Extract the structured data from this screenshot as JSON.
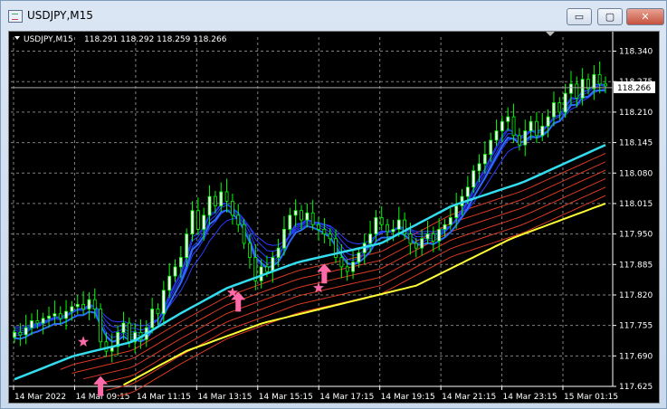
{
  "window": {
    "title": "USDJPY,M15",
    "controls": {
      "minimize": "▭",
      "maximize": "▢",
      "close": "✕"
    }
  },
  "chart_header": {
    "symbol": "USDJPY,M15",
    "ohlc": "118.291 118.292 118.259 118.266"
  },
  "colors": {
    "background": "#000000",
    "grid": "#808080",
    "axis_text": "#ffffff",
    "candle_up": "#00ff00",
    "candle_body_up": "#ffffff",
    "candle_down": "#00ff00",
    "blue_ma": "#2a3bff",
    "cyan_ma": "#33ddee",
    "red_ma": "#d93a22",
    "yellow_ma": "#ffff33",
    "markers": "#ff6aa8"
  },
  "chart_data": {
    "type": "candlestick",
    "price_axis": {
      "ticks": [
        "118.340",
        "118.275",
        "118.210",
        "118.145",
        "118.080",
        "118.015",
        "117.950",
        "117.885",
        "117.820",
        "117.755",
        "117.690",
        "117.625"
      ],
      "range": [
        117.625,
        118.37
      ],
      "current_price": "118.266"
    },
    "time_axis": {
      "ticks": [
        "14 Mar 2022",
        "14 Mar 09:15",
        "14 Mar 11:15",
        "14 Mar 13:15",
        "14 Mar 15:15",
        "14 Mar 17:15",
        "14 Mar 19:15",
        "14 Mar 21:15",
        "14 Mar 23:15",
        "15 Mar 01:15"
      ]
    },
    "close": [
      117.74,
      117.735,
      117.75,
      117.765,
      117.76,
      117.77,
      117.775,
      117.78,
      117.77,
      117.785,
      117.795,
      117.8,
      117.79,
      117.81,
      117.79,
      117.72,
      117.7,
      117.71,
      117.74,
      117.76,
      117.72,
      117.74,
      117.725,
      117.75,
      117.79,
      117.78,
      117.83,
      117.86,
      117.88,
      117.9,
      117.95,
      118.0,
      117.96,
      117.99,
      118.03,
      118.01,
      118.04,
      118.02,
      117.99,
      117.97,
      117.93,
      117.9,
      117.85,
      117.88,
      117.87,
      117.9,
      117.92,
      117.96,
      117.99,
      118.0,
      117.98,
      117.995,
      117.97,
      117.96,
      117.95,
      117.94,
      117.9,
      117.88,
      117.87,
      117.89,
      117.91,
      117.93,
      117.95,
      117.985,
      117.97,
      117.955,
      117.96,
      117.98,
      117.95,
      117.93,
      117.92,
      117.94,
      117.95,
      117.935,
      117.96,
      117.97,
      117.985,
      118.01,
      118.03,
      118.05,
      118.085,
      118.1,
      118.12,
      118.15,
      118.17,
      118.19,
      118.2,
      118.16,
      118.14,
      118.17,
      118.19,
      118.16,
      118.18,
      118.2,
      118.23,
      118.21,
      118.25,
      118.27,
      118.24,
      118.28,
      118.26,
      118.29,
      118.27,
      118.266
    ],
    "moving_averages": {
      "yellow": [
        [
          0.18,
          117.625
        ],
        [
          0.29,
          117.7
        ],
        [
          0.42,
          117.76
        ],
        [
          0.55,
          117.8
        ],
        [
          0.68,
          117.84
        ],
        [
          0.84,
          117.94
        ],
        [
          1.0,
          118.015
        ]
      ],
      "cyan": [
        [
          0.0,
          117.64
        ],
        [
          0.1,
          117.69
        ],
        [
          0.2,
          117.72
        ],
        [
          0.28,
          117.78
        ],
        [
          0.36,
          117.835
        ],
        [
          0.48,
          117.89
        ],
        [
          0.62,
          117.93
        ],
        [
          0.74,
          118.01
        ],
        [
          0.86,
          118.06
        ],
        [
          1.0,
          118.14
        ]
      ],
      "red_offsets": [
        -0.018,
        -0.036,
        -0.054,
        -0.072,
        -0.09,
        -0.108
      ],
      "blue_offsets": [
        0.018,
        0.032,
        0.046,
        0.06,
        0.074
      ]
    },
    "markers": {
      "up_arrows": [
        [
          15,
          117.62
        ],
        [
          39,
          117.8
        ],
        [
          54,
          117.86
        ]
      ],
      "stars": [
        [
          12,
          117.72
        ],
        [
          38,
          117.825
        ],
        [
          53,
          117.835
        ]
      ]
    }
  }
}
